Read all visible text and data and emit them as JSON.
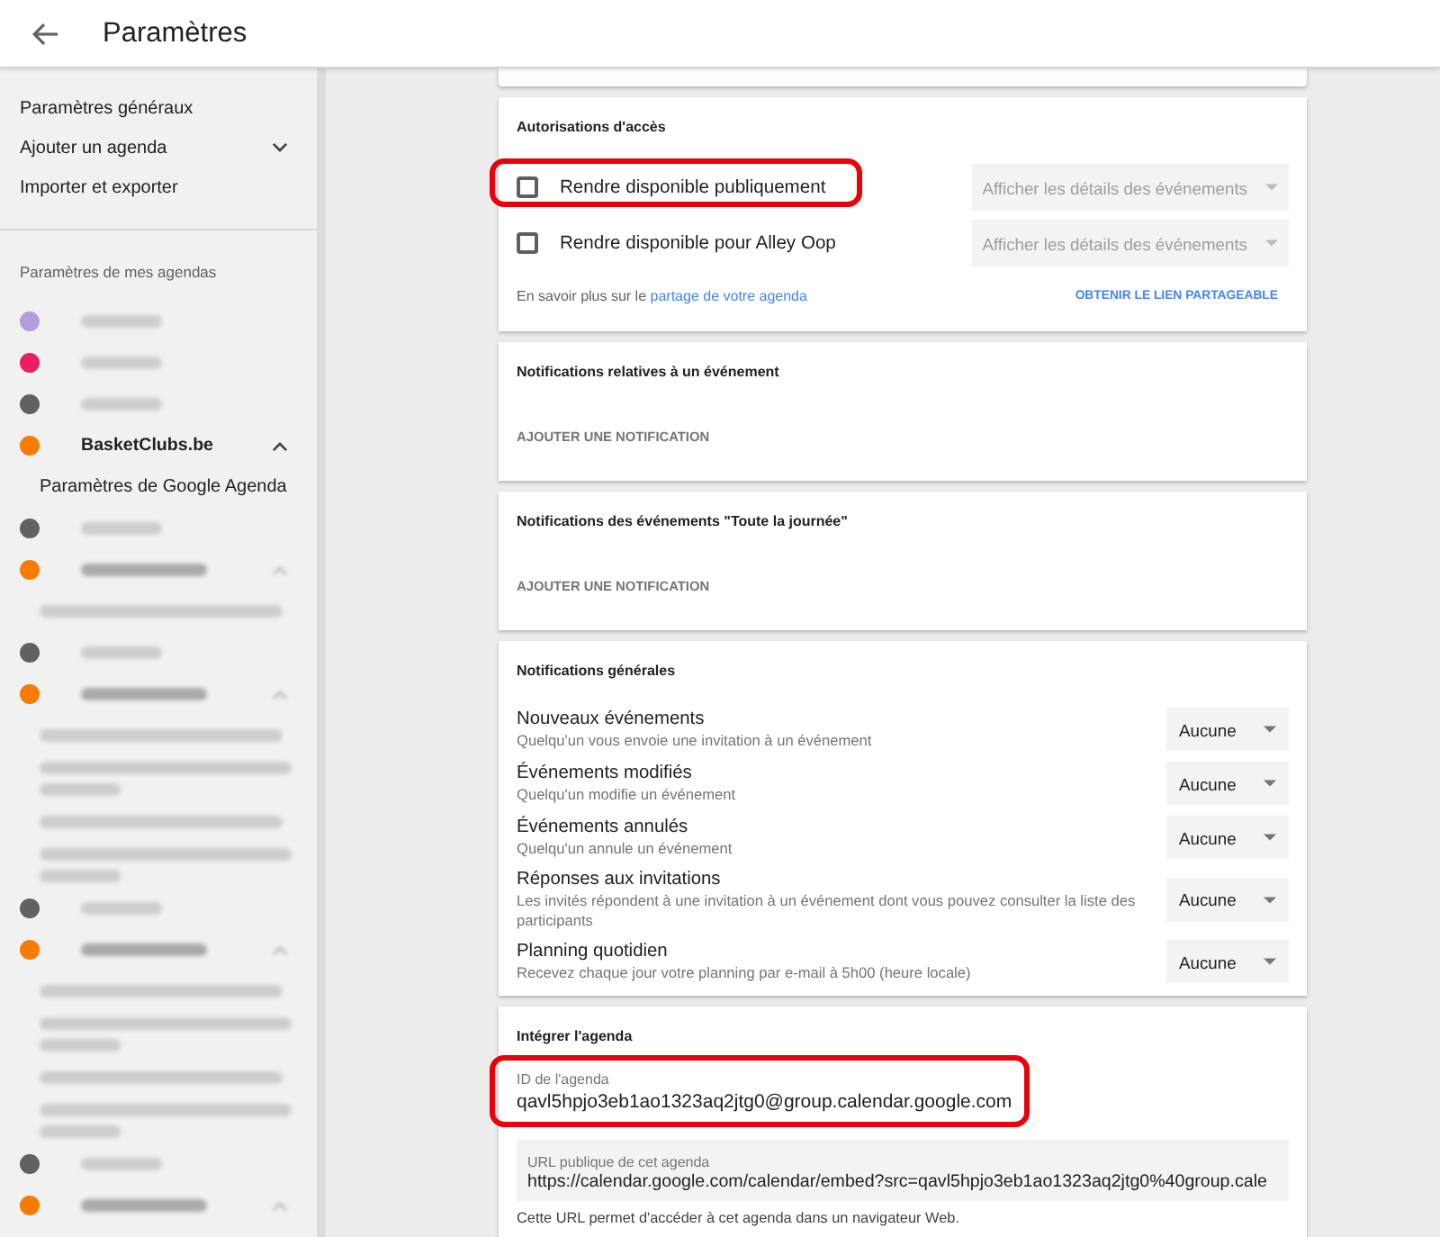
{
  "header": {
    "title": "Paramètres"
  },
  "sidebar": {
    "menu": [
      {
        "kind": "link",
        "label": "Paramètres généraux"
      },
      {
        "kind": "dropdown",
        "label": "Ajouter un agenda",
        "expanded": false
      },
      {
        "kind": "link",
        "label": "Importer et exporter"
      }
    ],
    "section_title": "Paramètres de mes agendas",
    "calendars": [
      {
        "kind": "blurred",
        "color": "#b39ddb"
      },
      {
        "kind": "blurred",
        "color": "#e91e63"
      },
      {
        "kind": "blurred",
        "color": "#616161"
      },
      {
        "kind": "named",
        "name": "BasketClubs.be",
        "color": "#f57c00",
        "expanded": true,
        "children": [
          {
            "kind": "link",
            "label": "Paramètres de Google Agenda"
          }
        ]
      },
      {
        "kind": "blurred",
        "color": "#616161"
      },
      {
        "kind": "blurred",
        "color": "#f57c00",
        "expanded": true,
        "children": [
          {
            "kind": "blurred-line"
          }
        ]
      },
      {
        "kind": "blurred",
        "color": "#616161"
      },
      {
        "kind": "blurred",
        "color": "#f57c00",
        "expanded": true,
        "children": [
          {
            "kind": "blurred-line"
          },
          {
            "kind": "blurred-two-lines"
          },
          {
            "kind": "blurred-line"
          },
          {
            "kind": "blurred-two-lines"
          }
        ]
      },
      {
        "kind": "blurred",
        "color": "#616161"
      },
      {
        "kind": "blurred",
        "color": "#f57c00",
        "expanded": true,
        "children": [
          {
            "kind": "blurred-line"
          },
          {
            "kind": "blurred-two-lines"
          },
          {
            "kind": "blurred-line"
          },
          {
            "kind": "blurred-two-lines"
          }
        ]
      },
      {
        "kind": "blurred",
        "color": "#616161"
      },
      {
        "kind": "blurred",
        "color": "#f57c00",
        "expanded": true
      }
    ]
  },
  "access": {
    "title": "Autorisations d'accès",
    "rows": [
      {
        "label": "Rendre disponible publiquement",
        "checked": false,
        "highlighted": true,
        "select": {
          "value": "Afficher les détails des événements",
          "disabled": true
        }
      },
      {
        "label": "Rendre disponible pour Alley Oop",
        "checked": false,
        "highlighted": false,
        "select": {
          "value": "Afficher les détails des événements",
          "disabled": true
        }
      }
    ],
    "learn_more": {
      "text": "En savoir plus sur le",
      "link": "partage de votre agenda"
    },
    "get_link": "OBTENIR LE LIEN PARTAGEABLE"
  },
  "event_notifications": {
    "title": "Notifications relatives à un événement",
    "button": "AJOUTER UNE NOTIFICATION"
  },
  "all_day_notifications": {
    "title": "Notifications des événements \"Toute la journée\"",
    "button": "AJOUTER UNE NOTIFICATION"
  },
  "general_notifications": {
    "title": "Notifications générales",
    "rows": [
      {
        "title": "Nouveaux événements",
        "description": "Quelqu'un vous envoie une invitation à un événement",
        "value": "Aucune"
      },
      {
        "title": "Événements modifiés",
        "description": "Quelqu'un modifie un événement",
        "value": "Aucune"
      },
      {
        "title": "Événements annulés",
        "description": "Quelqu'un annule un événement",
        "value": "Aucune"
      },
      {
        "title": "Réponses aux invitations",
        "description": "Les invités répondent à une invitation à un événement dont vous pouvez consulter la liste des participants",
        "value": "Aucune"
      },
      {
        "title": "Planning quotidien",
        "description": "Recevez chaque jour votre planning par e-mail à 5h00 (heure locale)",
        "value": "Aucune"
      }
    ]
  },
  "embed": {
    "title": "Intégrer l'agenda",
    "id_field": {
      "label": "ID de l'agenda",
      "value": "qavl5hpjo3eb1ao1323aq2jtg0@group.calendar.google.com",
      "highlighted": true
    },
    "url_field": {
      "label": "URL publique de cet agenda",
      "value": "https://calendar.google.com/calendar/embed?src=qavl5hpjo3eb1ao1323aq2jtg0%40group.cale"
    },
    "help": "Cette URL permet d'accéder à cet agenda dans un navigateur Web."
  }
}
